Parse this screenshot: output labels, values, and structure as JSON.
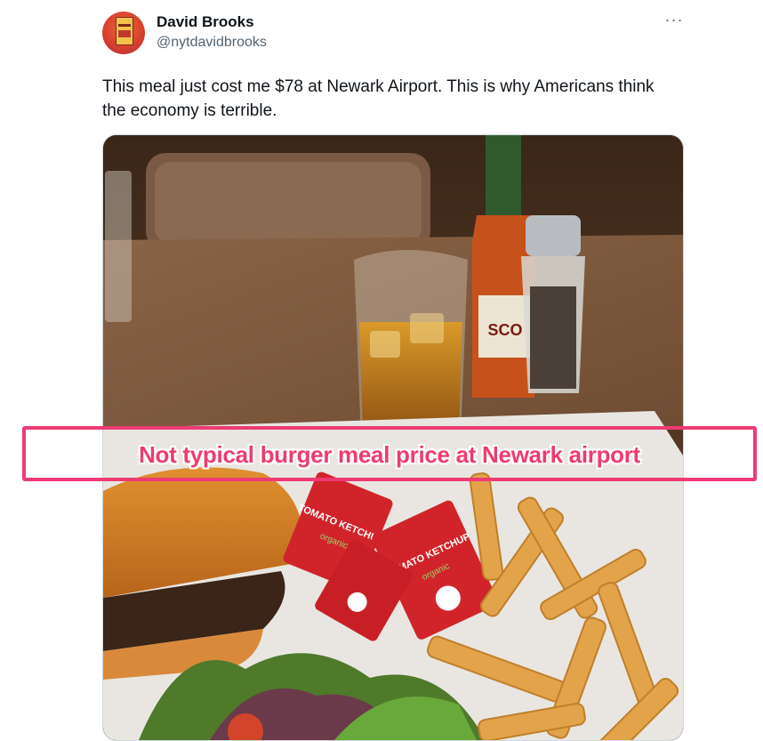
{
  "author": {
    "name": "David Brooks",
    "handle": "@nytdavidbrooks",
    "avatar_icon": "avatar-book-cover"
  },
  "more_icon": "more-options-icon",
  "tweet": {
    "text": "This meal just cost me $78 at Newark Airport. This is why Americans think the economy is terrible."
  },
  "photo": {
    "ketchup_label": "TOMATO KETCHUP",
    "ketchup_sublabel": "organic"
  },
  "annotation": {
    "text": "Not typical burger meal price at Newark airport",
    "color": "#ee3b73"
  }
}
